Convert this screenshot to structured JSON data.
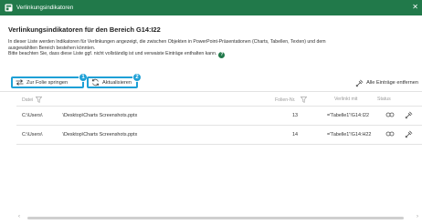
{
  "window": {
    "title": "Verlinkungsindikatoren"
  },
  "header": {
    "heading": "Verlinkungsindikatoren für den Bereich G14:I22",
    "description_line1": "In dieser Liste werden Indikatoren für Verlinkungen angezeigt, die zwischen Objekten in PowerPoint-Präsentationen (Charts, Tabellen, Texten) und dem",
    "description_line2": "ausgewählten Bereich bestehen könnten.",
    "description_line3": "Bitte beachten Sie, dass diese Liste ggf. nicht vollständig ist und verwaiste Einträge enthalten kann.",
    "help_label": "?"
  },
  "toolbar": {
    "goto_slide_label": "Zur Folie springen",
    "refresh_label": "Aktualisieren",
    "remove_all_label": "Alle Einträge entfernen",
    "badge1": "1",
    "badge2": "2"
  },
  "table": {
    "columns": {
      "file": "Datei",
      "slide": "Folien-Nr.",
      "linked": "Verlinkt mit",
      "status": "Status"
    },
    "rows": [
      {
        "file_prefix": "C:\\Users\\",
        "file_suffix": "\\Desktop\\Charts Screenshots.pptx",
        "slide": "13",
        "linked": "='Tabelle1'!G14:I22"
      },
      {
        "file_prefix": "C:\\Users\\",
        "file_suffix": "\\Desktop\\Charts Screenshots.pptx",
        "slide": "14",
        "linked": "='Tabelle1'!G14:H22"
      }
    ]
  },
  "colors": {
    "titlebar": "#21794a",
    "highlight": "#1ea0d6"
  },
  "icons": [
    "app-icon",
    "close-icon",
    "help-icon",
    "swap-arrows-icon",
    "refresh-icon",
    "remove-all-icon",
    "filter-icon",
    "link-status-icon",
    "remove-entry-icon",
    "scroll-left-icon",
    "scroll-right-icon"
  ]
}
